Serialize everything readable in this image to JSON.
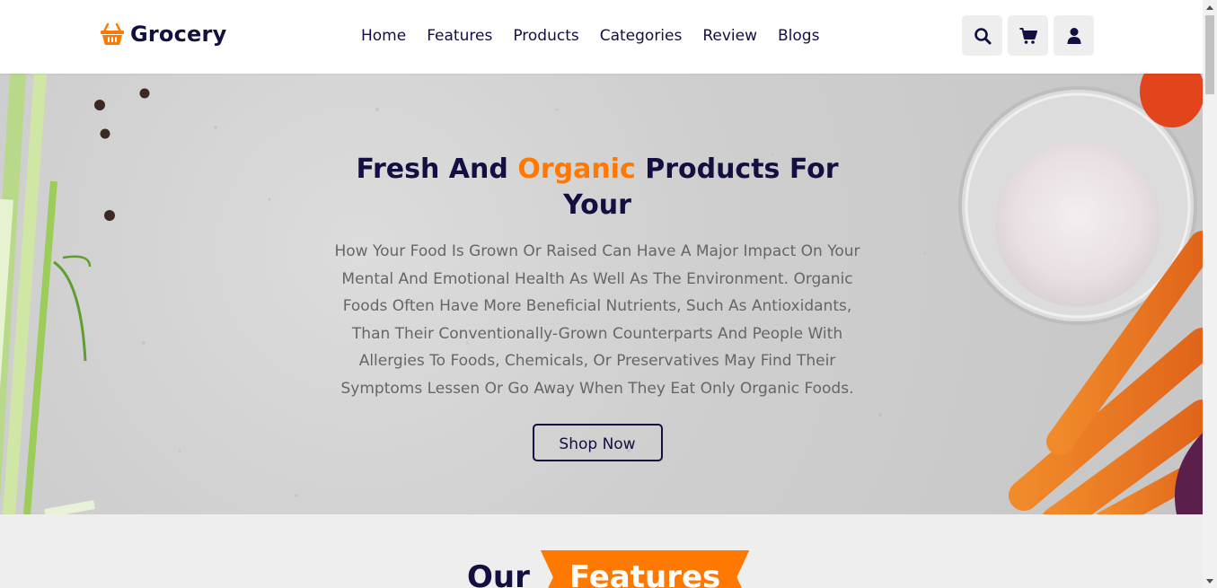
{
  "header": {
    "logo_text": "Grocery",
    "logo_icon": "shopping-basket-icon",
    "nav": [
      "Home",
      "Features",
      "Products",
      "Categories",
      "Review",
      "Blogs"
    ],
    "icons": [
      "search-icon",
      "cart-icon",
      "user-icon"
    ]
  },
  "hero": {
    "title_part1": "Fresh And ",
    "title_accent": "Organic",
    "title_part2": " Products For Your",
    "description": "How Your Food Is Grown Or Raised Can Have A Major Impact On Your Mental And Emotional Health As Well As The Environment. Organic Foods Often Have More Beneficial Nutrients, Such As Antioxidants, Than Their Conventionally-Grown Counterparts And People With Allergies To Foods, Chemicals, Or Preservatives May Find Their Symptoms Lessen Or Go Away When They Eat Only Organic Foods.",
    "button_label": "Shop Now"
  },
  "features": {
    "heading_plain": "Our",
    "heading_highlight": "Features"
  },
  "colors": {
    "primary": "#130f40",
    "accent": "#ff7800",
    "text_muted": "#666666",
    "bg_light": "#eeeeee"
  }
}
